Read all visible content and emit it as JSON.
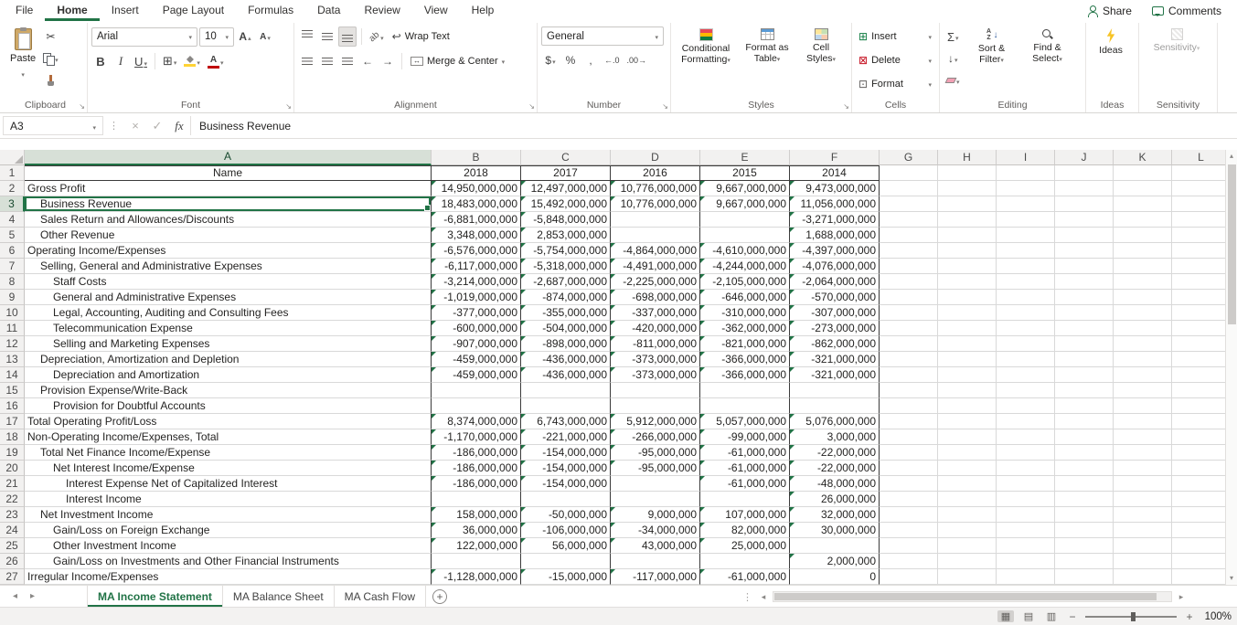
{
  "colors": {
    "accent": "#217346",
    "fill_swatch": "#ffd335",
    "font_swatch": "#c00000",
    "flag_triangle": "#217346"
  },
  "menu": {
    "tabs": [
      "File",
      "Home",
      "Insert",
      "Page Layout",
      "Formulas",
      "Data",
      "Review",
      "View",
      "Help"
    ],
    "active_tab": "Home",
    "share_label": "Share",
    "comments_label": "Comments"
  },
  "ribbon": {
    "clipboard": {
      "group_label": "Clipboard",
      "paste_label": "Paste"
    },
    "font": {
      "group_label": "Font",
      "font_name": "Arial",
      "font_size": "10"
    },
    "alignment": {
      "group_label": "Alignment",
      "wrap_text_label": "Wrap Text",
      "merge_center_label": "Merge & Center"
    },
    "number": {
      "group_label": "Number",
      "format_value": "General"
    },
    "styles": {
      "group_label": "Styles",
      "conditional_formatting_label": "Conditional Formatting",
      "format_as_table_label": "Format as Table",
      "cell_styles_label": "Cell Styles"
    },
    "cells": {
      "group_label": "Cells",
      "insert_label": "Insert",
      "delete_label": "Delete",
      "format_label": "Format"
    },
    "editing": {
      "group_label": "Editing",
      "sort_filter_label": "Sort & Filter",
      "find_select_label": "Find & Select"
    },
    "ideas": {
      "group_label": "Ideas",
      "ideas_label": "Ideas"
    },
    "sensitivity": {
      "group_label": "Sensitivity",
      "sensitivity_label": "Sensitivity"
    }
  },
  "icons": {
    "cut": "✂",
    "bold": "B",
    "italic": "I",
    "underline": "U",
    "letter_a": "A",
    "borders": "⊞",
    "dollar": "$",
    "percent": "%",
    "comma": ",",
    "increase_decimal": "←.0",
    "decrease_decimal": ".00→",
    "indent_decrease": "←",
    "indent_increase": "→",
    "orientation": "ab",
    "wrap_return": "↩",
    "merge_arrows": "↔",
    "sum": "Σ",
    "fill_down": "↓",
    "insert_cells": "⊞",
    "delete_cells": "⊠",
    "format_cells": "⊡",
    "sort_az": "AZ",
    "arrow_down": "↓",
    "cancel": "×",
    "enter": "✓",
    "function": "fx",
    "dots": "⋮",
    "nav_prev": "◂",
    "nav_next": "▸",
    "up": "▴",
    "down": "▾",
    "plus": "+",
    "minus": "−",
    "launcher": "↘",
    "view_normal": "▦",
    "view_layout": "▤",
    "view_break": "▥"
  },
  "formula_bar": {
    "name_box": "A3",
    "formula_text": "Business Revenue"
  },
  "grid": {
    "column_letters": [
      "A",
      "B",
      "C",
      "D",
      "E",
      "F",
      "G",
      "H",
      "I",
      "J",
      "K",
      "L"
    ],
    "selected_cell": "A3",
    "header": {
      "n": "1",
      "name": "Name",
      "years": [
        "2018",
        "2017",
        "2016",
        "2015",
        "2014"
      ]
    },
    "rows": [
      {
        "n": 2,
        "label": "Gross Profit",
        "indent": 0,
        "values": [
          "14,950,000,000",
          "12,497,000,000",
          "10,776,000,000",
          "9,667,000,000",
          "9,473,000,000"
        ]
      },
      {
        "n": 3,
        "label": "Business Revenue",
        "indent": 1,
        "values": [
          "18,483,000,000",
          "15,492,000,000",
          "10,776,000,000",
          "9,667,000,000",
          "11,056,000,000"
        ]
      },
      {
        "n": 4,
        "label": "Sales Return and Allowances/Discounts",
        "indent": 1,
        "values": [
          "-6,881,000,000",
          "-5,848,000,000",
          "",
          "",
          "-3,271,000,000"
        ]
      },
      {
        "n": 5,
        "label": "Other Revenue",
        "indent": 1,
        "values": [
          "3,348,000,000",
          "2,853,000,000",
          "",
          "",
          "1,688,000,000"
        ]
      },
      {
        "n": 6,
        "label": "Operating Income/Expenses",
        "indent": 0,
        "values": [
          "-6,576,000,000",
          "-5,754,000,000",
          "-4,864,000,000",
          "-4,610,000,000",
          "-4,397,000,000"
        ]
      },
      {
        "n": 7,
        "label": "Selling, General and Administrative Expenses",
        "indent": 1,
        "values": [
          "-6,117,000,000",
          "-5,318,000,000",
          "-4,491,000,000",
          "-4,244,000,000",
          "-4,076,000,000"
        ]
      },
      {
        "n": 8,
        "label": "Staff Costs",
        "indent": 2,
        "values": [
          "-3,214,000,000",
          "-2,687,000,000",
          "-2,225,000,000",
          "-2,105,000,000",
          "-2,064,000,000"
        ]
      },
      {
        "n": 9,
        "label": "General and Administrative Expenses",
        "indent": 2,
        "values": [
          "-1,019,000,000",
          "-874,000,000",
          "-698,000,000",
          "-646,000,000",
          "-570,000,000"
        ]
      },
      {
        "n": 10,
        "label": "Legal, Accounting, Auditing and Consulting Fees",
        "indent": 2,
        "values": [
          "-377,000,000",
          "-355,000,000",
          "-337,000,000",
          "-310,000,000",
          "-307,000,000"
        ]
      },
      {
        "n": 11,
        "label": "Telecommunication Expense",
        "indent": 2,
        "values": [
          "-600,000,000",
          "-504,000,000",
          "-420,000,000",
          "-362,000,000",
          "-273,000,000"
        ]
      },
      {
        "n": 12,
        "label": "Selling and Marketing Expenses",
        "indent": 2,
        "values": [
          "-907,000,000",
          "-898,000,000",
          "-811,000,000",
          "-821,000,000",
          "-862,000,000"
        ]
      },
      {
        "n": 13,
        "label": "Depreciation, Amortization and Depletion",
        "indent": 1,
        "values": [
          "-459,000,000",
          "-436,000,000",
          "-373,000,000",
          "-366,000,000",
          "-321,000,000"
        ]
      },
      {
        "n": 14,
        "label": "Depreciation and Amortization",
        "indent": 2,
        "values": [
          "-459,000,000",
          "-436,000,000",
          "-373,000,000",
          "-366,000,000",
          "-321,000,000"
        ]
      },
      {
        "n": 15,
        "label": "Provision Expense/Write-Back",
        "indent": 1,
        "values": [
          "",
          "",
          "",
          "",
          ""
        ]
      },
      {
        "n": 16,
        "label": "Provision for Doubtful Accounts",
        "indent": 2,
        "values": [
          "",
          "",
          "",
          "",
          ""
        ]
      },
      {
        "n": 17,
        "label": "Total Operating Profit/Loss",
        "indent": 0,
        "values": [
          "8,374,000,000",
          "6,743,000,000",
          "5,912,000,000",
          "5,057,000,000",
          "5,076,000,000"
        ]
      },
      {
        "n": 18,
        "label": "Non-Operating Income/Expenses, Total",
        "indent": 0,
        "values": [
          "-1,170,000,000",
          "-221,000,000",
          "-266,000,000",
          "-99,000,000",
          "3,000,000"
        ]
      },
      {
        "n": 19,
        "label": "Total Net Finance Income/Expense",
        "indent": 1,
        "values": [
          "-186,000,000",
          "-154,000,000",
          "-95,000,000",
          "-61,000,000",
          "-22,000,000"
        ]
      },
      {
        "n": 20,
        "label": "Net Interest Income/Expense",
        "indent": 2,
        "values": [
          "-186,000,000",
          "-154,000,000",
          "-95,000,000",
          "-61,000,000",
          "-22,000,000"
        ]
      },
      {
        "n": 21,
        "label": "Interest Expense Net of Capitalized Interest",
        "indent": 3,
        "values": [
          "-186,000,000",
          "-154,000,000",
          "",
          "-61,000,000",
          "-48,000,000"
        ]
      },
      {
        "n": 22,
        "label": "Interest Income",
        "indent": 3,
        "values": [
          "",
          "",
          "",
          "",
          "26,000,000"
        ]
      },
      {
        "n": 23,
        "label": "Net Investment Income",
        "indent": 1,
        "values": [
          "158,000,000",
          "-50,000,000",
          "9,000,000",
          "107,000,000",
          "32,000,000"
        ]
      },
      {
        "n": 24,
        "label": "Gain/Loss on Foreign Exchange",
        "indent": 2,
        "values": [
          "36,000,000",
          "-106,000,000",
          "-34,000,000",
          "82,000,000",
          "30,000,000"
        ]
      },
      {
        "n": 25,
        "label": "Other Investment Income",
        "indent": 2,
        "values": [
          "122,000,000",
          "56,000,000",
          "43,000,000",
          "25,000,000",
          ""
        ]
      },
      {
        "n": 26,
        "label": "Gain/Loss on Investments and Other Financial Instruments",
        "indent": 2,
        "values": [
          "",
          "",
          "",
          "",
          "2,000,000"
        ]
      },
      {
        "n": 27,
        "label": "Irregular Income/Expenses",
        "indent": 0,
        "values": [
          "-1,128,000,000",
          "-15,000,000",
          "-117,000,000",
          "-61,000,000",
          "0"
        ]
      }
    ]
  },
  "sheet_bar": {
    "tabs": [
      "MA Income Statement",
      "MA Balance Sheet",
      "MA Cash Flow"
    ],
    "active": "MA Income Statement"
  },
  "status_bar": {
    "zoom": "100%"
  }
}
